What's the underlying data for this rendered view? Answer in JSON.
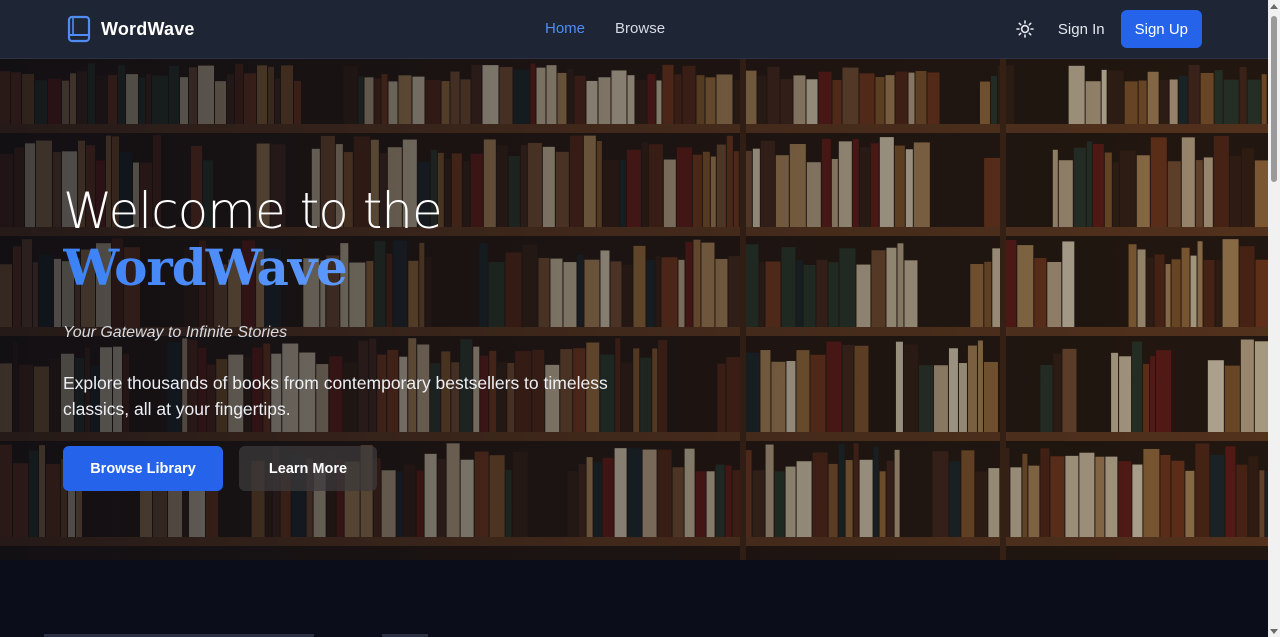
{
  "navbar": {
    "brand": "WordWave",
    "links": [
      {
        "label": "Home",
        "active": true
      },
      {
        "label": "Browse",
        "active": false
      }
    ],
    "theme_icon": "sun-icon",
    "signin_label": "Sign In",
    "signup_label": "Sign Up"
  },
  "hero": {
    "title_line1": "Welcome to the",
    "title_line2": "WordWave",
    "tagline": "Your Gateway to Infinite Stories",
    "description": "Explore thousands of books from contemporary bestsellers to timeless classics, all at your fingertips.",
    "primary_button": "Browse Library",
    "secondary_button": "Learn More",
    "background": "bookshelf-image"
  },
  "colors": {
    "accent": "#2563eb",
    "nav_bg": "#1e2535",
    "page_bg": "#0b0e1a",
    "active_link": "#4f8cf5"
  }
}
